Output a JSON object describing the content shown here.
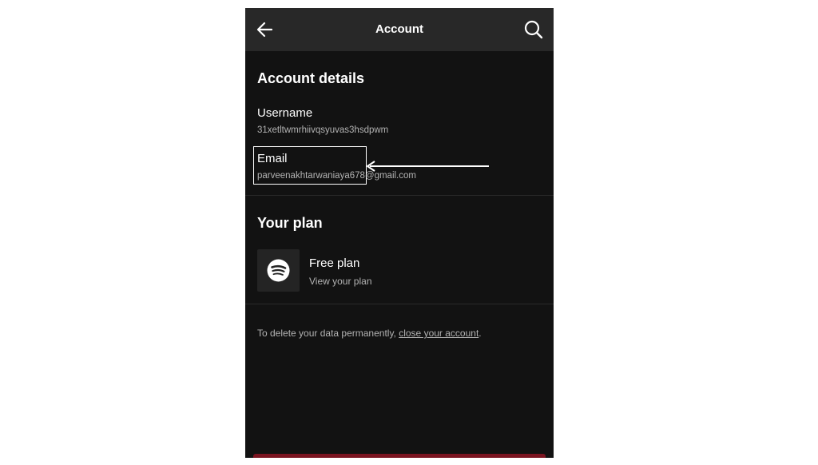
{
  "header": {
    "title": "Account",
    "back_icon": "arrow-left-icon",
    "search_icon": "search-icon"
  },
  "account_details": {
    "heading": "Account details",
    "username_label": "Username",
    "username_value": "31xetltwmrhiivqsyuvas3hsdpwm",
    "email_label": "Email",
    "email_value": "parveenakhtarwaniaya678@gmail.com"
  },
  "plan": {
    "heading": "Your plan",
    "name": "Free plan",
    "link": "View your plan",
    "icon": "spotify-logo-icon"
  },
  "footer_note": {
    "prefix": "To delete your data permanently, ",
    "link": "close your account",
    "suffix": "."
  },
  "colors": {
    "background": "#121212",
    "header": "#282828",
    "text_primary": "#ffffff",
    "text_secondary": "#b3b3b3"
  }
}
